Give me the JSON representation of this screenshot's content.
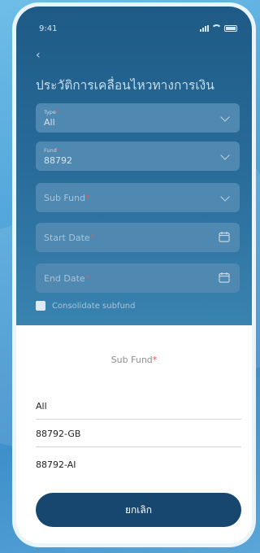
{
  "status": {
    "time": "9:41"
  },
  "page": {
    "title": "ประวัติการเคลื่อนไหวทางการเงิน"
  },
  "filters": {
    "type": {
      "label": "Type",
      "value": "All"
    },
    "fund": {
      "label": "Fund",
      "value": "88792"
    },
    "sub_fund": {
      "placeholder": "Sub Fund"
    },
    "start_date": {
      "placeholder": "Start Date"
    },
    "end_date": {
      "placeholder": "End Date"
    },
    "consolidate_label": "Consolidate subfund"
  },
  "required_mark": "*",
  "sheet": {
    "title": "Sub Fund",
    "options": [
      "All",
      "88792-GB",
      "88792-AI"
    ],
    "cancel_label": "ยกเลิก"
  },
  "colors": {
    "accent": "#17476f",
    "required": "#e8555a"
  }
}
